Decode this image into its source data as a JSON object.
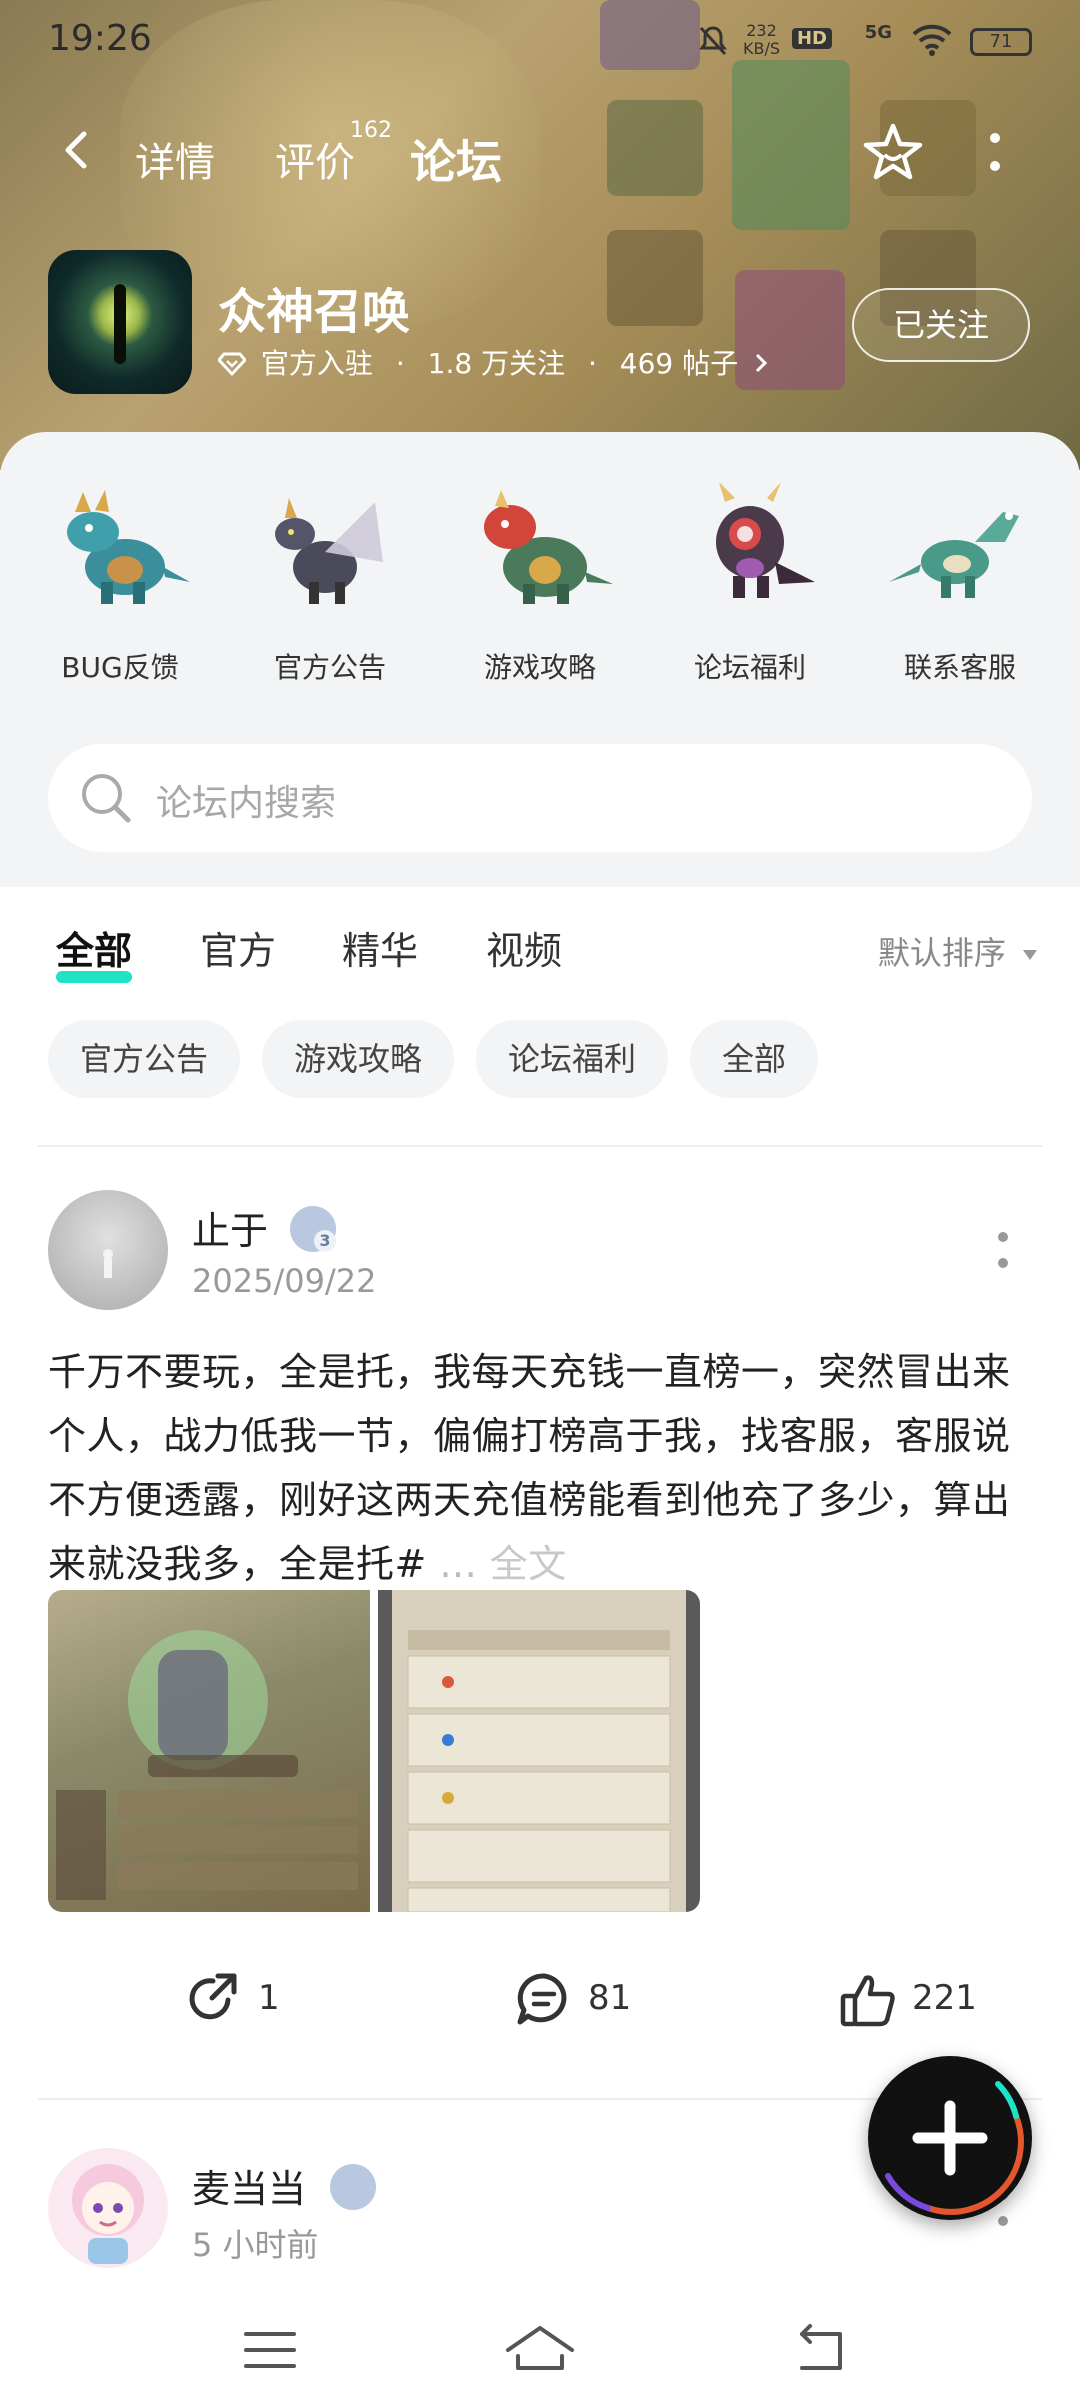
{
  "status_bar": {
    "time": "19:26",
    "net_speed": "232",
    "net_unit": "KB/S",
    "hd": "HD",
    "signal": "5G",
    "battery": "71"
  },
  "top_nav": {
    "tabs": [
      {
        "label": "详情"
      },
      {
        "label": "评价",
        "badge": "162"
      },
      {
        "label": "论坛"
      }
    ]
  },
  "game": {
    "title": "众神召唤",
    "official": "官方入驻",
    "followers": "1.8 万关注",
    "posts": "469 帖子",
    "follow_button": "已关注"
  },
  "quick_links": [
    {
      "label": "BUG反馈"
    },
    {
      "label": "官方公告"
    },
    {
      "label": "游戏攻略"
    },
    {
      "label": "论坛福利"
    },
    {
      "label": "联系客服"
    }
  ],
  "search": {
    "placeholder": "论坛内搜索"
  },
  "filter_tabs": [
    {
      "label": "全部"
    },
    {
      "label": "官方"
    },
    {
      "label": "精华"
    },
    {
      "label": "视频"
    }
  ],
  "sort_label": "默认排序",
  "chips": [
    "官方公告",
    "游戏攻略",
    "论坛福利",
    "全部"
  ],
  "posts": [
    {
      "user": "止于",
      "level": "3",
      "time": "2025/09/22",
      "text": "千万不要玩，全是托，我每天充钱一直榜一，突然冒出来个人，战力低我一节，偏偏打榜高于我，找客服，客服说不方便透露，刚好这两天充值榜能看到他充了多少，算出来就没我多，全是托#",
      "ellipsis": "...",
      "full_text": "全文",
      "shares": "1",
      "comments": "81",
      "likes": "221"
    },
    {
      "user": "麦当当",
      "time": "5 小时前"
    }
  ],
  "colors": {
    "accent": "#1ee3c5",
    "text": "#222222",
    "muted": "#999999"
  }
}
